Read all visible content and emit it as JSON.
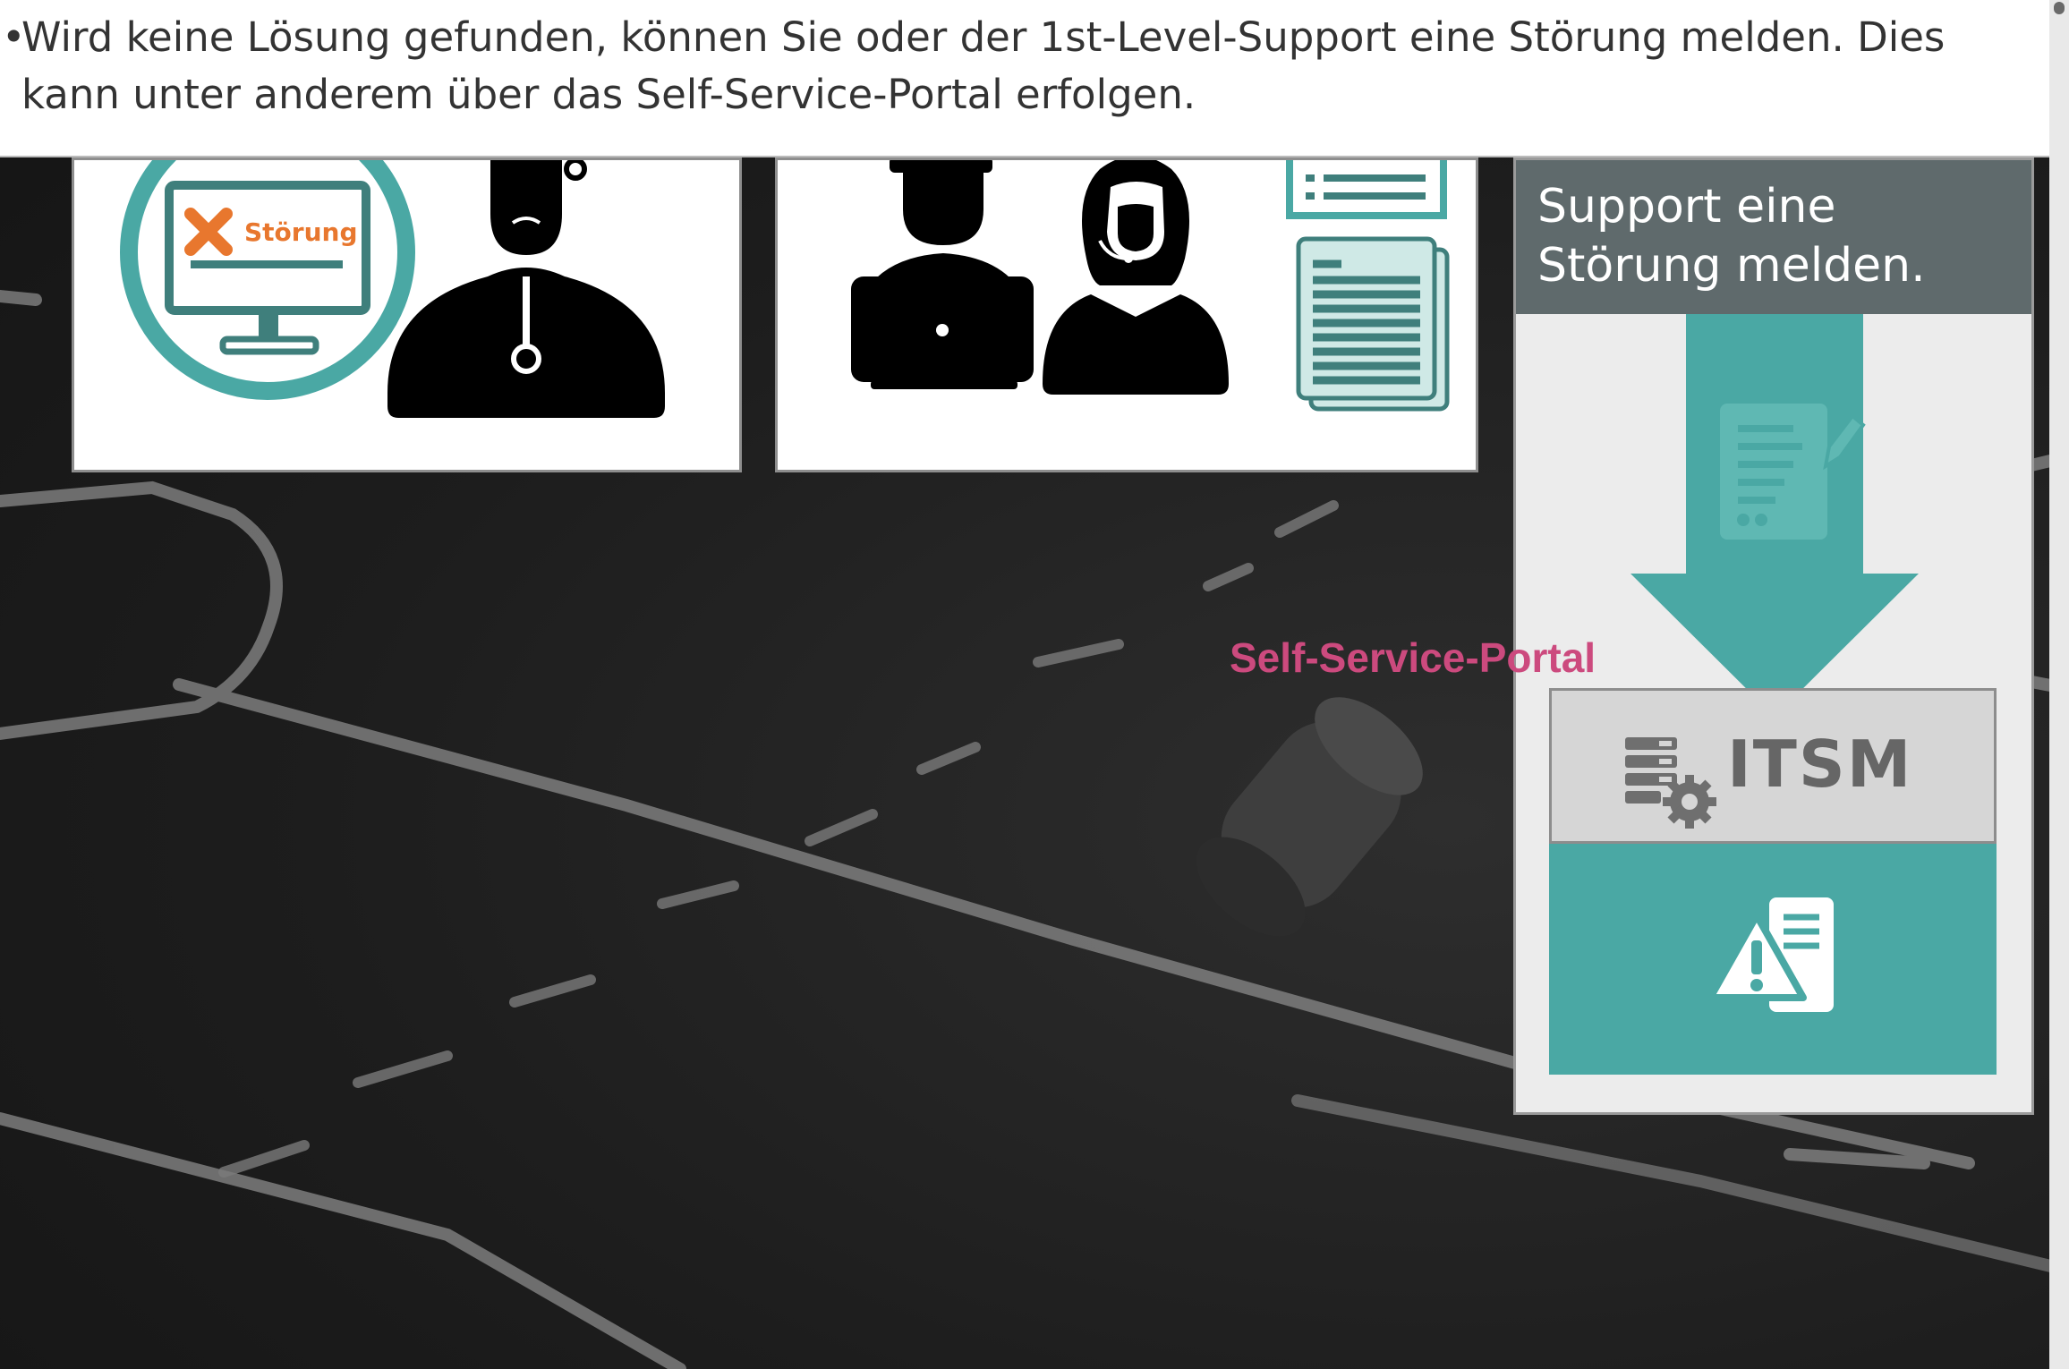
{
  "caption": {
    "bullet": "•",
    "line1": "Wird keine Lösung gefunden, können Sie oder der 1st-Level-Support eine Störung melden. Dies",
    "line2": "kann unter anderem über das Self-Service-Portal erfolgen."
  },
  "card_left": {
    "monitor_label": "Störung",
    "icons": [
      "monitor-error-icon",
      "doctor-icon"
    ]
  },
  "card_middle": {
    "icons": [
      "user-laptop-icon",
      "support-agent-headset-icon",
      "documents-icon"
    ]
  },
  "panel": {
    "line1": "Support eine",
    "line2": "Störung melden.",
    "itsm_label": "ITSM",
    "icons": [
      "form-edit-icon",
      "down-arrow-icon",
      "server-gear-icon",
      "warning-server-icon"
    ]
  },
  "portal_label": "Self-Service-Portal",
  "colors": {
    "teal": "#4aa8a4",
    "teal_light": "#cfe9e6",
    "orange": "#e8772e",
    "panel_head": "#5f6a6c",
    "portal_label": "#cc4a7e",
    "board": "#1c1c1c"
  }
}
